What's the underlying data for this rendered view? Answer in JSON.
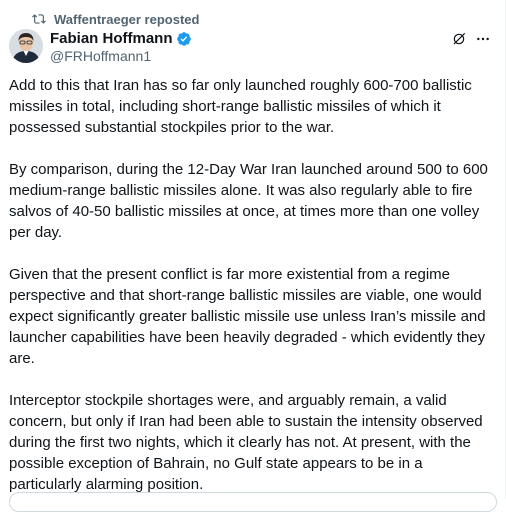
{
  "repost": {
    "text": "Waffentraeger reposted",
    "icon": "repost-icon"
  },
  "author": {
    "display_name": "Fabian Hoffmann",
    "handle": "@FRHoffmann1",
    "verified": true,
    "verified_color": "#1d9bf0"
  },
  "actions": {
    "grok_icon": "grok-icon",
    "more_icon": "more-icon"
  },
  "tweet": {
    "paragraphs": [
      "Add to this that Iran has so far only launched roughly 600-700 ballistic missiles in total, including short-range ballistic missiles of which it possessed substantial stockpiles prior to the war.",
      "By comparison, during the 12-Day War Iran launched around 500 to 600 medium-range ballistic missiles alone. It was also regularly able to fire salvos of 40-50 ballistic missiles at once, at times more than one volley per day.",
      "Given that the present conflict is far more existential from a regime perspective and that short-range ballistic missiles are viable, one would expect significantly greater ballistic missile use unless Iran’s missile and launcher capabilities have been heavily degraded - which evidently they are.",
      "Interceptor stockpile shortages were, and arguably remain, a valid concern, but only if Iran had been able to sustain the intensity observed during the first two nights, which it clearly has not. At present, with the possible exception of Bahrain, no Gulf state appears to be in a particularly alarming position."
    ]
  },
  "colors": {
    "text_primary": "#0f1419",
    "text_secondary": "#536471",
    "border": "#cfd9de"
  }
}
